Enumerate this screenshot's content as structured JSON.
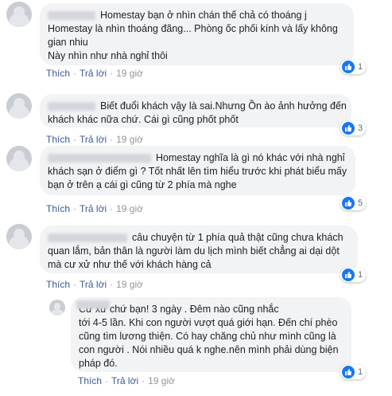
{
  "actions": {
    "like": "Thích",
    "reply": "Trả lời",
    "separator": "·"
  },
  "comments": [
    {
      "lines": [
        "Homestay bạn ở nhìn chán thế chả có thoáng j",
        "Homestay là nhìn thoáng đãng... Phòng ốc phối kính và lấy không",
        "gian nhiu",
        "Này nhìn như nhà nghỉ thôi"
      ],
      "time": "19 giờ",
      "reactions": "1"
    },
    {
      "lines": [
        "Biết đuổi khách vậy là sai.Nhưng Ồn ào ảnh hưởng đến",
        "khách khác nữa chứ. Cái gì cũng phốt phốt"
      ],
      "time": "19 giờ",
      "reactions": "3"
    },
    {
      "lines": [
        "Homestay nghĩa là gì nó khác với nhà nghỉ",
        "khách sạn ở điểm gì ? Tốt nhất lên tìm hiểu trước khi phát biểu mấy",
        "bạn ở trên ạ cái gì cũng từ 2 phía mà nghe"
      ],
      "time": "19 giờ",
      "reactions": "5"
    },
    {
      "lines": [
        "câu chuyện từ 1 phía quả thật cũng chưa khách",
        "quan lắm, bản thân là người làm du lịch mình biết chẳng ai dại dột",
        "mà cư xử như thế với khách hàng cả"
      ],
      "time": "19 giờ",
      "reactions": "1"
    },
    {
      "lines": [
        "Cư xử chứ bạn! 3 ngày . Đêm nào cũng nhắc",
        "tới 4-5 lần. Khi con người vượt quá giới hạn. Đến chí phèo",
        "cũng tìm lương thiện. Có hay chăng chủ như mình cũng là",
        "con người . Nói nhiều quá k nghe.nên mình phải dùng biện",
        "pháp đó."
      ],
      "time": "19 giờ",
      "reactions": "1"
    }
  ]
}
